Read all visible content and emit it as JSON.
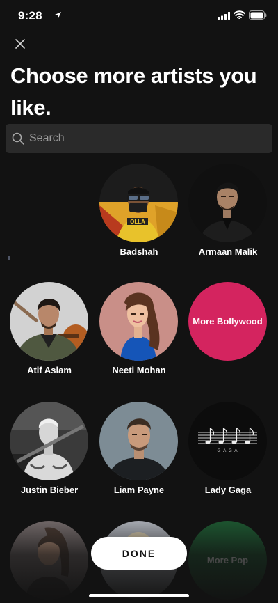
{
  "status_bar": {
    "time": "9:28"
  },
  "header": {
    "title": "Choose more artists you like."
  },
  "search": {
    "placeholder": "Search"
  },
  "artists": [
    {
      "name": "Badshah"
    },
    {
      "name": "Armaan Malik"
    },
    {
      "name": "Atif Aslam"
    },
    {
      "name": "Neeti Mohan"
    },
    {
      "name": "Justin Bieber"
    },
    {
      "name": "Liam Payne"
    },
    {
      "name": "Lady Gaga"
    }
  ],
  "more_tiles": [
    {
      "label": "More Bollywood",
      "color": "#d4245f"
    },
    {
      "label": "More Pop",
      "color": "#1e5c33"
    }
  ],
  "album_art": {
    "label": "G A G A"
  },
  "cta": {
    "done_label": "DONE"
  }
}
